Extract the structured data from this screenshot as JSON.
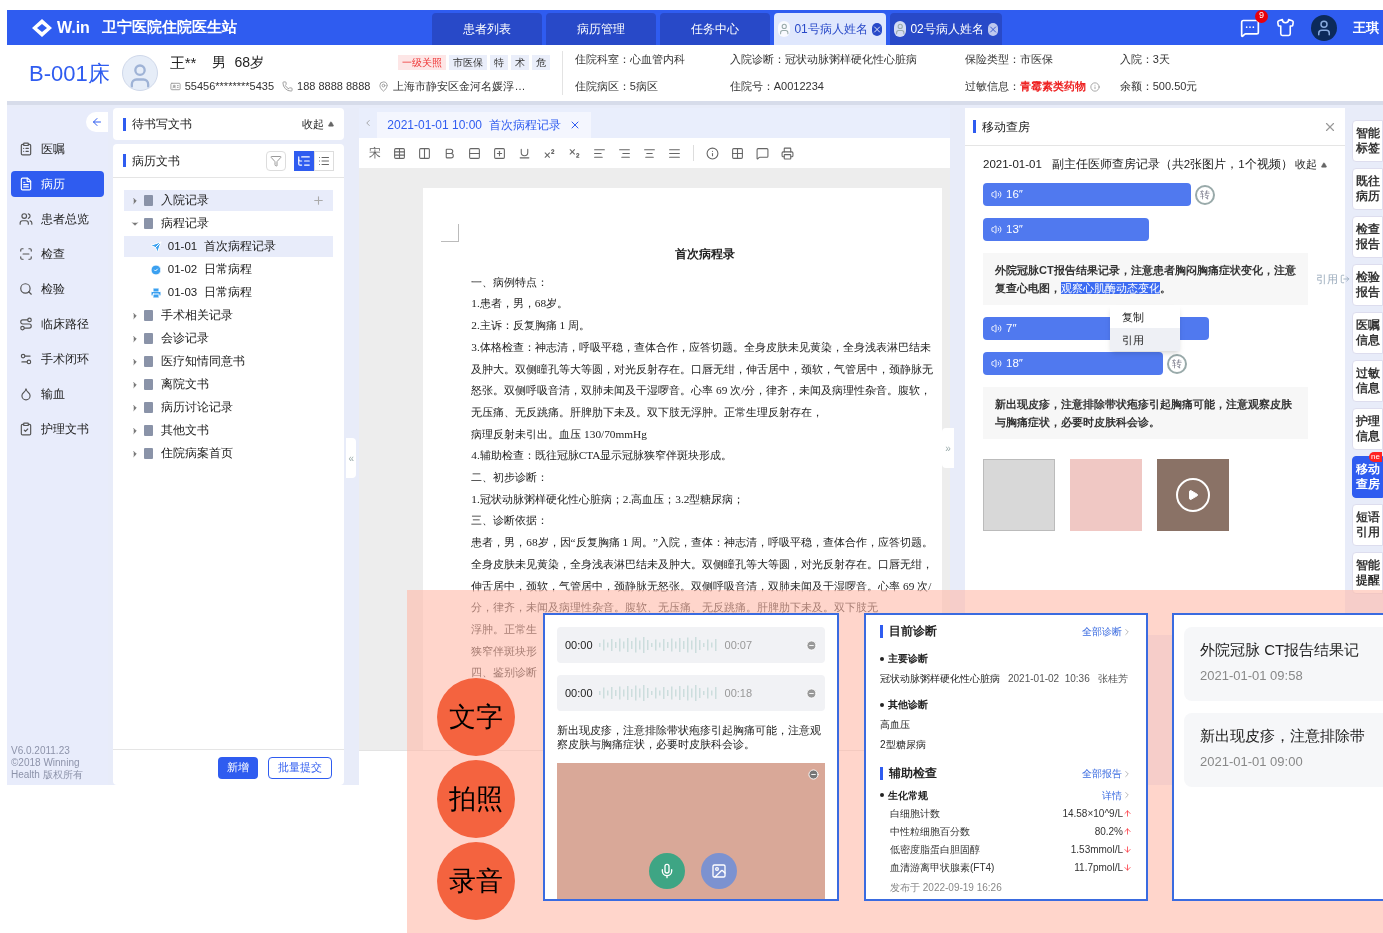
{
  "topbar": {
    "logo": "W.in",
    "title": "卫宁医院住院医生站",
    "tabs": [
      {
        "label": "患者列表",
        "kind": "menu",
        "selected": false
      },
      {
        "label": "病历管理",
        "kind": "menu",
        "selected": false
      },
      {
        "label": "任务中心",
        "kind": "menu",
        "selected": false
      },
      {
        "label": "01号病人姓名",
        "kind": "patient",
        "selected": true
      },
      {
        "label": "02号病人姓名",
        "kind": "patient",
        "selected": false
      }
    ],
    "message_count": "9",
    "user": "王琪"
  },
  "patient": {
    "bed": "B-001床",
    "name": "王**",
    "sex": "男",
    "age": "68岁",
    "tags": [
      {
        "label": "一级关照",
        "kind": "alert"
      },
      {
        "label": "市医保",
        "kind": "plain"
      },
      {
        "label": "特",
        "kind": "plain"
      },
      {
        "label": "术",
        "kind": "plain"
      },
      {
        "label": "危",
        "kind": "plain"
      }
    ],
    "id_number": "55456********5435",
    "phone": "188 8888 8888",
    "address": "上海市静安区金河名媛浮…",
    "info": [
      {
        "label": "住院科室：",
        "value": "心血管内科",
        "kind": "plain"
      },
      {
        "label": "入院诊断：",
        "value": "冠状动脉粥样硬化性心脏病",
        "kind": "plain"
      },
      {
        "label": "保险类型：",
        "value": "市医保",
        "kind": "plain"
      },
      {
        "label": "入院：",
        "value": "3天",
        "kind": "plain"
      },
      {
        "label": "住院病区：",
        "value": "5病区",
        "kind": "plain"
      },
      {
        "label": "住院号：",
        "value": "A0012234",
        "kind": "plain"
      },
      {
        "label": "过敏信息：",
        "value": "青霉素类药物",
        "kind": "alert"
      },
      {
        "label": "余额：",
        "value": "500.50元",
        "kind": "plain"
      }
    ]
  },
  "nav": {
    "items": [
      {
        "label": "医嘱",
        "selected": false
      },
      {
        "label": "病历",
        "selected": true
      },
      {
        "label": "患者总览",
        "selected": false
      },
      {
        "label": "检查",
        "selected": false
      },
      {
        "label": "检验",
        "selected": false
      },
      {
        "label": "临床路径",
        "selected": false
      },
      {
        "label": "手术闭环",
        "selected": false
      },
      {
        "label": "输血",
        "selected": false
      },
      {
        "label": "护理文书",
        "selected": false
      }
    ],
    "version": "V6.0.2011.23",
    "copyright": "©2018 Winning Health 版权所有"
  },
  "docs_panel": {
    "pending_title": "待书写文书",
    "collapse": "收起",
    "title": "病历文书",
    "views": [
      {
        "kind": "tree",
        "selected": true
      },
      {
        "kind": "list",
        "selected": false
      }
    ],
    "tree": [
      {
        "label": "入院记录",
        "expanded": false,
        "hovered": true
      },
      {
        "label": "病程记录",
        "expanded": true,
        "hovered": false,
        "children": [
          {
            "label": "01-01  首次病程记录",
            "kind": "sent",
            "selected": true
          },
          {
            "label": "01-02  日常病程",
            "kind": "signed",
            "selected": false
          },
          {
            "label": "01-03  日常病程",
            "kind": "printed",
            "selected": false
          }
        ]
      },
      {
        "label": "手术相关记录",
        "expanded": false,
        "hovered": false
      },
      {
        "label": "会诊记录",
        "expanded": false,
        "hovered": false
      },
      {
        "label": "医疗知情同意书",
        "expanded": false,
        "hovered": false
      },
      {
        "label": "离院文书",
        "expanded": false,
        "hovered": false
      },
      {
        "label": "病历讨论记录",
        "expanded": false,
        "hovered": false
      },
      {
        "label": "其他文书",
        "expanded": false,
        "hovered": false
      },
      {
        "label": "住院病案首页",
        "expanded": false,
        "hovered": false
      }
    ],
    "buttons": [
      {
        "label": "新增",
        "kind": "primary"
      },
      {
        "label": "批量提交",
        "kind": "outline"
      }
    ],
    "collapse_arrow": "«"
  },
  "editor": {
    "tab": "2021-01-01 10:00  首次病程记录",
    "font_button": "宋",
    "expand_arrow": "»",
    "doc_title": "首次病程录",
    "paragraphs": [
      "一、病例特点：",
      "1.患者，男，68岁。",
      "2.主诉：反复胸痛 1 周。",
      "3.体格检查：神志清，呼吸平稳，查体合作，应答切题。全身皮肤未见黄染，全身浅表淋巴结未及肿大。双侧瞳孔等大等圆，对光反射存在。口唇无绀，伸舌居中，颈软，气管居中，颈静脉无怒张。双侧呼吸音清，双肺未闻及干湿啰音。心率 69 次/分，律齐，未闻及病理性杂音。腹软，无压痛、无反跳痛。肝脾肋下未及。双下肢无浮肿。正常生理反射存在，",
      "病理反射未引出。血压 130/70mmHg",
      "4.辅助检查：既往冠脉CTA显示冠脉狭窄伴斑块形成。",
      "二、初步诊断：",
      "1.冠状动脉粥样硬化性心脏病；2.高血压；3.2型糖尿病；",
      "三、诊断依据：",
      "患者，男，68岁，因“反复胸痛 1 周。”入院，查体：神志清，呼吸平稳，查体合作，应答切题。全身皮肤未见黄染，全身浅表淋巴结未及肿大。双侧瞳孔等大等圆，对光反射存在。口唇无绀，伸舌居中，颈软，气管居中，颈静脉无怒张。双侧呼吸音清，双肺未闻及干湿啰音。心率 69 次/分，律齐，未闻及病理性杂音。腹软、无压痛、无反跳痛。肝脾肋下未及。双下肢无",
      "浮肿。正常生",
      "狭窄伴斑块形",
      "四、鉴别诊断"
    ]
  },
  "rounds": {
    "title": "移动查房",
    "record_date": "2021-01-01",
    "record_title": "副主任医师查房记录（共2张图片，1个视频）",
    "collapse": "收起",
    "items": [
      {
        "kind": "voice",
        "duration": "16″",
        "convert_label": "转"
      },
      {
        "kind": "voice",
        "duration": "13″"
      },
      {
        "kind": "text",
        "text": "外院冠脉CT报告结果记录，注意患者胸闷胸痛症状变化，注意复查心电图，",
        "selected_text": "观察心肌酶动态变化",
        "text_after": "。",
        "quote_label": "引用"
      },
      {
        "kind": "voice",
        "duration": "7″"
      },
      {
        "kind": "voice",
        "duration": "18″",
        "convert_label": "转"
      },
      {
        "kind": "text",
        "text": "新出现皮疹，注意排除带状疱疹引起胸痛可能，注意观察皮肤与胸痛症状，必要时皮肤科会诊。"
      }
    ],
    "context_menu": [
      {
        "label": "复制",
        "selected": false
      },
      {
        "label": "引用",
        "selected": true
      }
    ],
    "media": [
      {
        "kind": "document"
      },
      {
        "kind": "photo"
      },
      {
        "kind": "video"
      }
    ]
  },
  "tools": [
    {
      "label": "智能标签",
      "selected": false
    },
    {
      "label": "既往病历",
      "selected": false
    },
    {
      "label": "检查报告",
      "selected": false
    },
    {
      "label": "检验报告",
      "selected": false
    },
    {
      "label": "医嘱信息",
      "selected": false
    },
    {
      "label": "过敏信息",
      "selected": false
    },
    {
      "label": "护理信息",
      "selected": false
    },
    {
      "label": "移动查房",
      "selected": true,
      "badge": "ne"
    },
    {
      "label": "短语引用",
      "selected": false
    },
    {
      "label": "智能提醒",
      "selected": false
    }
  ],
  "showcase": {
    "labels": [
      "文字",
      "拍照",
      "录音"
    ],
    "note_card": {
      "voices": [
        {
          "start": "00:00",
          "end": "00:07"
        },
        {
          "start": "00:00",
          "end": "00:18"
        }
      ],
      "text": "新出现皮疹，注意排除带状疱疹引起胸痛可能，注意观察皮肤与胸痛症状，必要时皮肤科会诊。"
    },
    "diagnosis_card": {
      "title": "目前诊断",
      "link": "全部诊断",
      "main_label": "主要诊断",
      "main": "冠状动脉粥样硬化性心脏病",
      "main_time": "2021-01-02  10:36",
      "main_doctor": "张桂芳",
      "other_label": "其他诊断",
      "others": [
        "高血压",
        "2型糖尿病"
      ],
      "exam_title": "辅助检查",
      "exam_link": "全部报告",
      "panel": "生化常规",
      "detail": "详情",
      "results": [
        {
          "name": "白细胞计数",
          "value": "14.58×10^9/L",
          "kind": "up"
        },
        {
          "name": "中性粒细胞百分数",
          "value": "80.2%",
          "kind": "up"
        },
        {
          "name": "低密度脂蛋白胆固醇",
          "value": "1.53mmol/L",
          "kind": "down"
        },
        {
          "name": "血清游离甲状腺素(FT4)",
          "value": "11.7pmol/L",
          "kind": "down"
        }
      ],
      "published": "发布于  2022-09-19 16:26"
    },
    "list_card": [
      {
        "title": "外院冠脉 CT报告结果记",
        "time": "2021-01-01 09:58"
      },
      {
        "title": "新出现皮疹，注意排除带",
        "time": "2021-01-01 09:00"
      }
    ]
  }
}
